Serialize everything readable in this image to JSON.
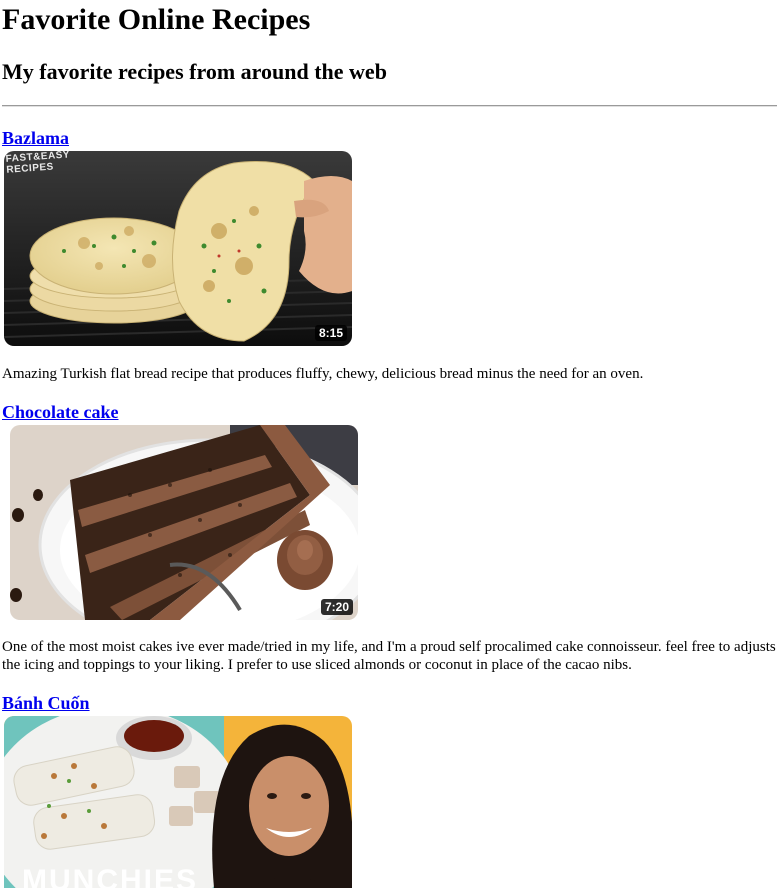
{
  "page": {
    "title": "Favorite Online Recipes",
    "subtitle": "My favorite recipes from around the web"
  },
  "recipes": [
    {
      "title": "Bazlama",
      "duration": "8:15",
      "channel_tag": "FAST&EASY RECIPES",
      "description": "Amazing Turkish flat bread recipe that produces fluffy, chewy, delicious bread minus the need for an oven."
    },
    {
      "title": "Chocolate cake",
      "duration": "7:20",
      "description": "One of the most moist cakes ive ever made/tried in my life, and I'm a proud self procalimed cake connoisseur. feel free to adjusts the icing and toppings to your liking. I prefer to use sliced almonds or coconut in place of the cacao nibs."
    },
    {
      "title": "Bánh Cuốn",
      "channel_tag": "MUNCHIES"
    }
  ],
  "colors": {
    "link": "#0000ee",
    "divider": "#9a9a9a"
  }
}
